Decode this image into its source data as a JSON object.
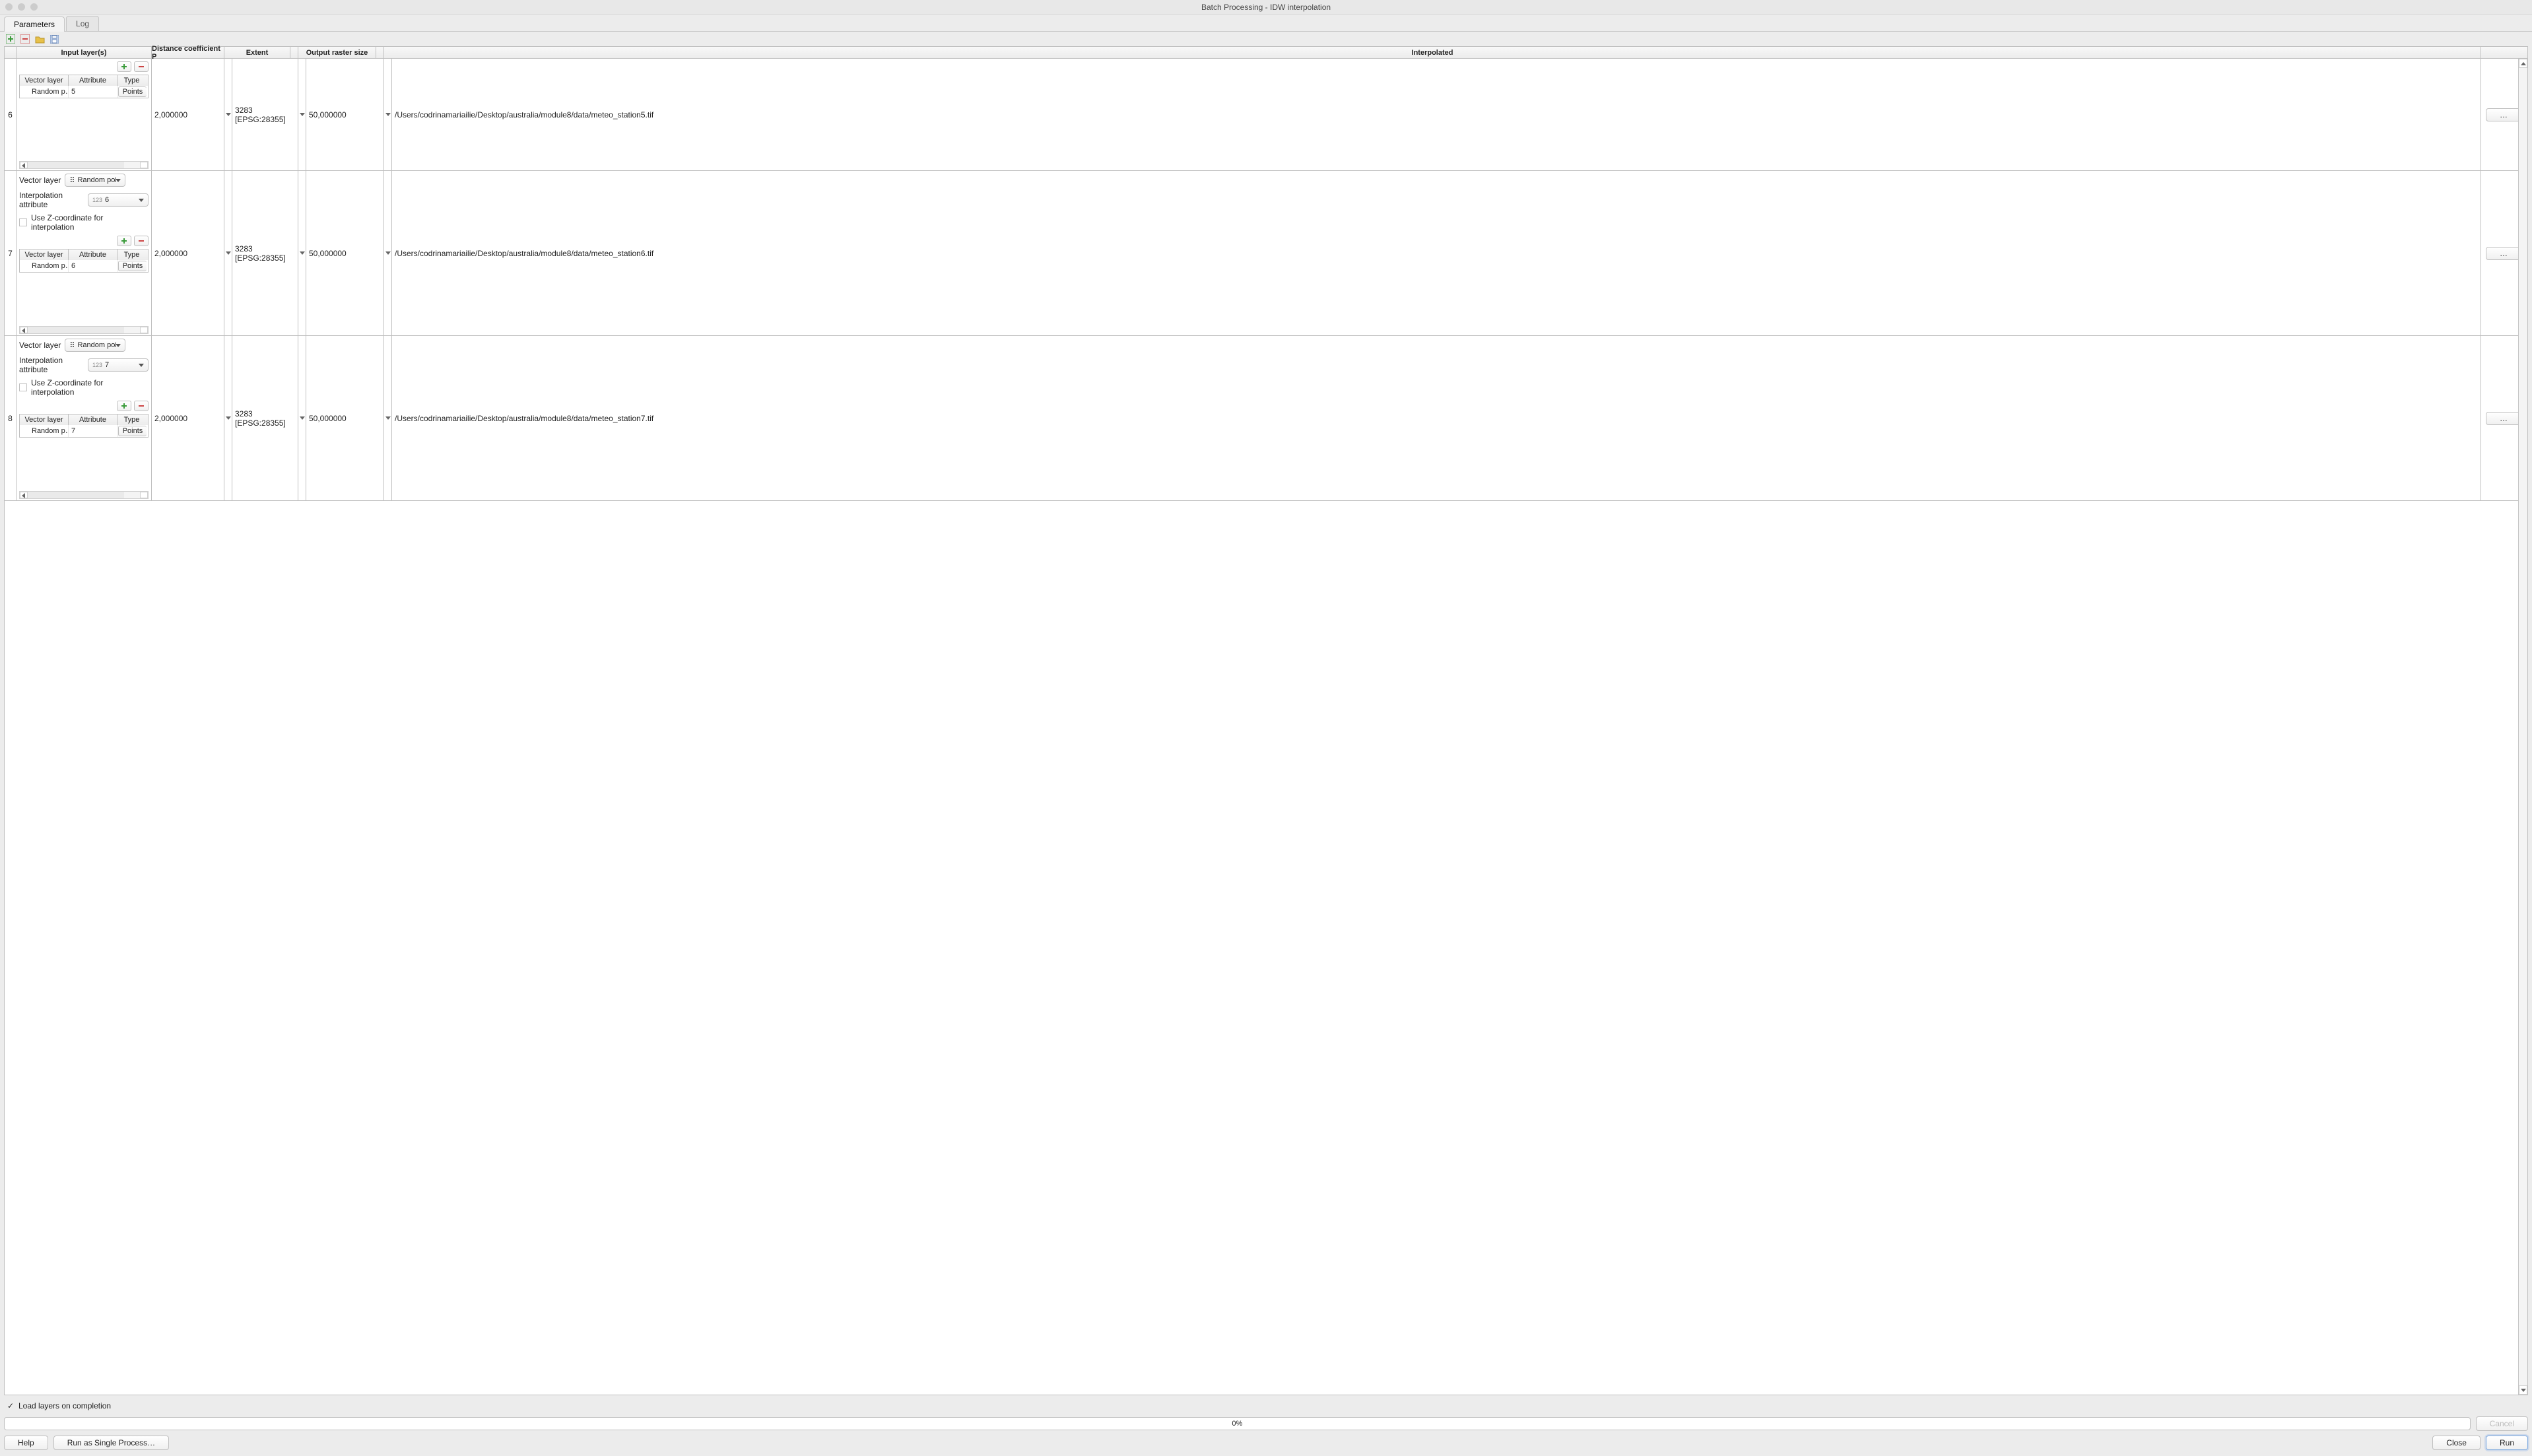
{
  "window_title": "Batch Processing - IDW interpolation",
  "tabs": {
    "parameters": "Parameters",
    "log": "Log"
  },
  "columns": {
    "input": "Input layer(s)",
    "distance": "Distance coefficient P",
    "extent": "Extent",
    "raster": "Output raster size",
    "interpolated": "Interpolated"
  },
  "labels": {
    "vector_layer": "Vector layer",
    "interp_attr": "Interpolation attribute",
    "use_z": "Use Z-coordinate for interpolation",
    "mt_vector": "Vector layer",
    "mt_attr": "Attribute",
    "mt_type": "Type",
    "browse": "…",
    "load_layers": "Load layers on completion"
  },
  "selects": {
    "layer_text": "Random poi",
    "attr_prefix": "123"
  },
  "rows": [
    {
      "num": "6",
      "short": true,
      "mt_vec": "Random p…",
      "mt_attr": "5",
      "mt_type": "Points",
      "distance": "2,000000",
      "extent": "3283 [EPSG:28355]",
      "raster": "50,000000",
      "out": "/Users/codrinamariailie/Desktop/australia/module8/data/meteo_station5.tif"
    },
    {
      "num": "7",
      "attr_sel": "6",
      "mt_vec": "Random p…",
      "mt_attr": "6",
      "mt_type": "Points",
      "distance": "2,000000",
      "extent": "3283 [EPSG:28355]",
      "raster": "50,000000",
      "out": "/Users/codrinamariailie/Desktop/australia/module8/data/meteo_station6.tif"
    },
    {
      "num": "8",
      "attr_sel": "7",
      "mt_vec": "Random p…",
      "mt_attr": "7",
      "mt_type": "Points",
      "distance": "2,000000",
      "extent": "3283 [EPSG:28355]",
      "raster": "50,000000",
      "out": "/Users/codrinamariailie/Desktop/australia/module8/data/meteo_station7.tif"
    }
  ],
  "progress": "0%",
  "buttons": {
    "cancel": "Cancel",
    "help": "Help",
    "run_single": "Run as Single Process…",
    "close": "Close",
    "run": "Run"
  }
}
